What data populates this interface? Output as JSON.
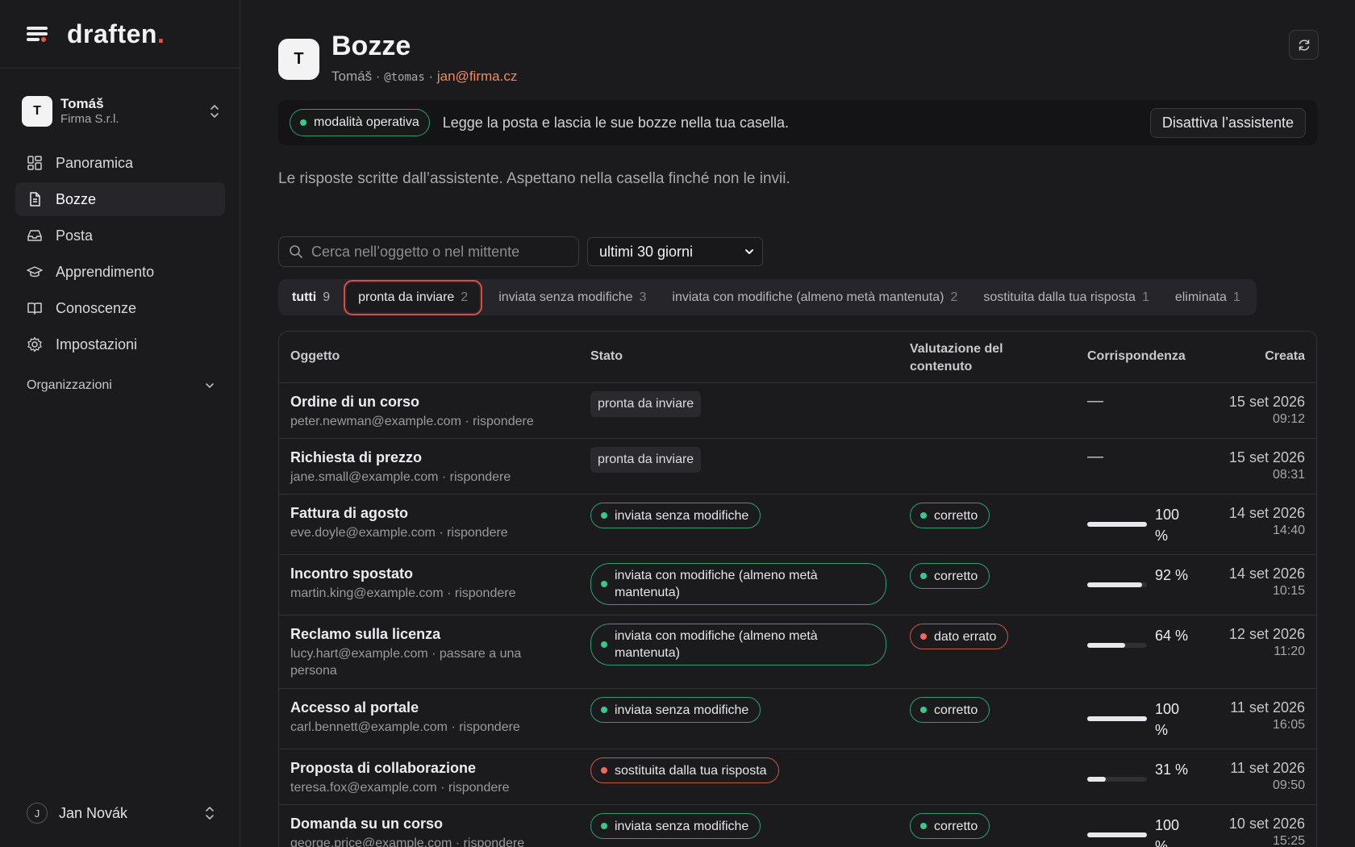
{
  "brand": {
    "name": "draften",
    "dot": "."
  },
  "account": {
    "initial": "T",
    "name": "Tomáš",
    "org": "Firma S.r.l."
  },
  "nav": [
    {
      "label": "Panoramica",
      "icon": "dashboard-icon"
    },
    {
      "label": "Bozze",
      "icon": "document-icon"
    },
    {
      "label": "Posta",
      "icon": "inbox-icon"
    },
    {
      "label": "Apprendimento",
      "icon": "graduation-cap-icon"
    },
    {
      "label": "Conoscenze",
      "icon": "book-icon"
    },
    {
      "label": "Impostazioni",
      "icon": "gear-icon"
    }
  ],
  "orgs_label": "Organizzazioni",
  "footer_user": {
    "initial": "J",
    "name": "Jan Novák"
  },
  "header": {
    "initial": "T",
    "title": "Bozze",
    "user": "Tomáš",
    "handle": "@tomas",
    "email": "jan@firma.cz"
  },
  "mode": {
    "pill": "modalità operativa",
    "text": "Legge la posta e lascia le sue bozze nella tua casella.",
    "button": "Disattiva l’assistente"
  },
  "description": "Le risposte scritte dall’assistente. Aspettano nella casella finché non le invii.",
  "search": {
    "placeholder": "Cerca nell’oggetto o nel mittente",
    "value": ""
  },
  "period": {
    "selected": "ultimi 30 giorni"
  },
  "tabs": [
    {
      "label": "tutti",
      "count": "9"
    },
    {
      "label": "pronta da inviare",
      "count": "2"
    },
    {
      "label": "inviata senza modifiche",
      "count": "3"
    },
    {
      "label": "inviata con modifiche (almeno metà mantenuta)",
      "count": "2"
    },
    {
      "label": "sostituita dalla tua risposta",
      "count": "1"
    },
    {
      "label": "eliminata",
      "count": "1"
    }
  ],
  "columns": {
    "subject": "Oggetto",
    "status": "Stato",
    "rating": "Valutazione del contenuto",
    "match": "Corrispondenza",
    "created": "Creata"
  },
  "rows": [
    {
      "subject": "Ordine di un corso",
      "meta": "peter.newman@example.com · rispondere",
      "status": "pronta da inviare",
      "status_kind": "plain",
      "rating": "",
      "rating_kind": "",
      "match": "—",
      "match_fraction": null,
      "date": "15 set 2026",
      "time": "09:12"
    },
    {
      "subject": "Richiesta di prezzo",
      "meta": "jane.small@example.com · rispondere",
      "status": "pronta da inviare",
      "status_kind": "plain",
      "rating": "",
      "rating_kind": "",
      "match": "—",
      "match_fraction": null,
      "date": "15 set 2026",
      "time": "08:31"
    },
    {
      "subject": "Fattura di agosto",
      "meta": "eve.doyle@example.com · rispondere",
      "status": "inviata senza modifiche",
      "status_kind": "green",
      "rating": "corretto",
      "rating_kind": "green",
      "match": "100 %",
      "match_fraction": 1.0,
      "date": "14 set 2026",
      "time": "14:40"
    },
    {
      "subject": "Incontro spostato",
      "meta": "martin.king@example.com · rispondere",
      "status": "inviata con modifiche (almeno metà mantenuta)",
      "status_kind": "green-wide",
      "rating": "corretto",
      "rating_kind": "green",
      "match": "92 %",
      "match_fraction": 0.92,
      "date": "14 set 2026",
      "time": "10:15"
    },
    {
      "subject": "Reclamo sulla licenza",
      "meta": "lucy.hart@example.com · passare a una persona",
      "status": "inviata con modifiche (almeno metà mantenuta)",
      "status_kind": "green-wide",
      "rating": "dato errato",
      "rating_kind": "red",
      "match": "64 %",
      "match_fraction": 0.64,
      "date": "12 set 2026",
      "time": "11:20"
    },
    {
      "subject": "Accesso al portale",
      "meta": "carl.bennett@example.com · rispondere",
      "status": "inviata senza modifiche",
      "status_kind": "green",
      "rating": "corretto",
      "rating_kind": "green",
      "match": "100 %",
      "match_fraction": 1.0,
      "date": "11 set 2026",
      "time": "16:05"
    },
    {
      "subject": "Proposta di collaborazione",
      "meta": "teresa.fox@example.com · rispondere",
      "status": "sostituita dalla tua risposta",
      "status_kind": "red",
      "rating": "",
      "rating_kind": "",
      "match": "31 %",
      "match_fraction": 0.31,
      "date": "11 set 2026",
      "time": "09:50"
    },
    {
      "subject": "Domanda su un corso",
      "meta": "george.price@example.com · rispondere",
      "status": "inviata senza modifiche",
      "status_kind": "green",
      "rating": "corretto",
      "rating_kind": "green",
      "match": "100 %",
      "match_fraction": 1.0,
      "date": "10 set 2026",
      "time": "15:25"
    }
  ],
  "colors": {
    "accent": "#e05a3b",
    "green": "#37c989",
    "red": "#f06a5c",
    "email": "#f08a5c"
  }
}
